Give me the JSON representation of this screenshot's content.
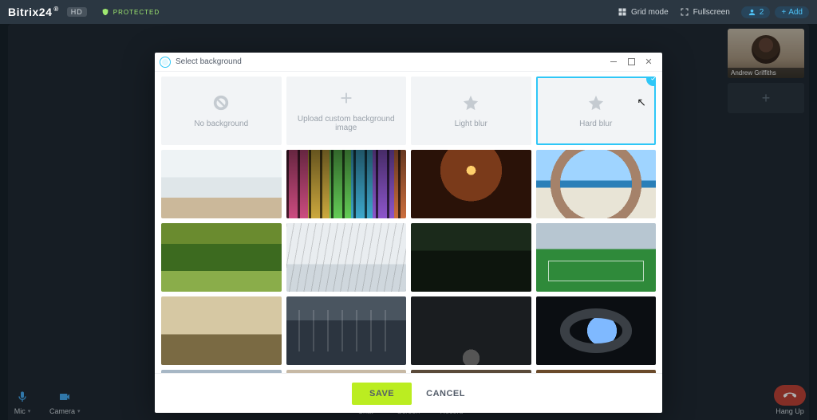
{
  "brand": {
    "name": "Bitrix24",
    "badge": "HD"
  },
  "protected_label": "PROTECTED",
  "topbar": {
    "grid_mode": "Grid mode",
    "fullscreen": "Fullscreen",
    "participants": "2",
    "add": "Add"
  },
  "participant": {
    "name": "Andrew Griffiths"
  },
  "controls": {
    "mic": "Mic",
    "camera": "Camera",
    "chat": "Chat",
    "screen": "Screen",
    "record": "Record",
    "hangup": "Hang Up"
  },
  "modal": {
    "title": "Select background",
    "options": {
      "no_bg": "No background",
      "upload": "Upload custom background image",
      "light_blur": "Light blur",
      "hard_blur": "Hard blur"
    },
    "save": "SAVE",
    "cancel": "CANCEL"
  }
}
